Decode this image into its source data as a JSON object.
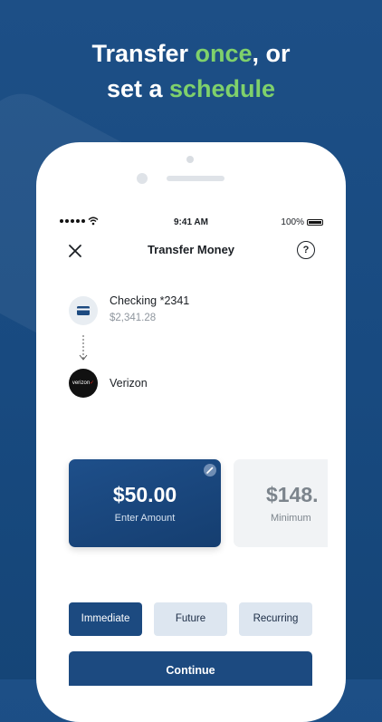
{
  "headline": {
    "line1_prefix": "Transfer ",
    "line1_accent": "once",
    "line1_suffix": ", or",
    "line2_prefix": "set a ",
    "line2_accent": "schedule"
  },
  "status_bar": {
    "time": "9:41 AM",
    "battery": "100%"
  },
  "nav": {
    "title": "Transfer Money",
    "help_symbol": "?"
  },
  "from_account": {
    "name": "Checking *2341",
    "balance": "$2,341.28"
  },
  "payee": {
    "name": "Verizon",
    "logo_text": "verizon",
    "logo_mark": "✓"
  },
  "amount_options": [
    {
      "value": "$50.00",
      "label": "Enter Amount",
      "selected": true
    },
    {
      "value": "$148.",
      "label": "Minimum",
      "selected": false
    }
  ],
  "frequency": {
    "immediate": "Immediate",
    "future": "Future",
    "recurring": "Recurring",
    "selected": "Immediate"
  },
  "continue_label": "Continue",
  "colors": {
    "background": "#1d4f86",
    "accent_green": "#7fd16b",
    "primary": "#1c4a80"
  }
}
